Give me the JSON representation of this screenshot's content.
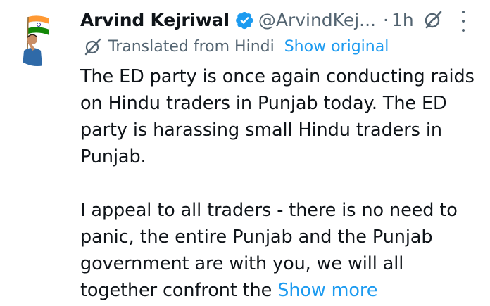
{
  "tweet": {
    "author_name": "Arvind Kejriwal",
    "handle": "@ArvindKej...",
    "separator": "·",
    "time": "1h",
    "translation_label": "Translated from Hindi",
    "show_original": "Show original",
    "paragraphs": [
      "The ED party is once again conducting raids on Hindu traders in Punjab today. The ED party is harassing small Hindu traders in Punjab.",
      "I appeal to all traders - there is no need to panic, the entire Punjab and the Punjab government are with you, we will all together confront the"
    ],
    "show_more": "Show more"
  },
  "icons": {
    "verified": "verified-badge-icon",
    "grok": "grok-icon",
    "more": "more-options-icon",
    "translate": "translate-icon"
  },
  "colors": {
    "text_primary": "#0f1419",
    "text_secondary": "#536471",
    "link": "#1d9bf0",
    "verified": "#1d9bf0"
  }
}
